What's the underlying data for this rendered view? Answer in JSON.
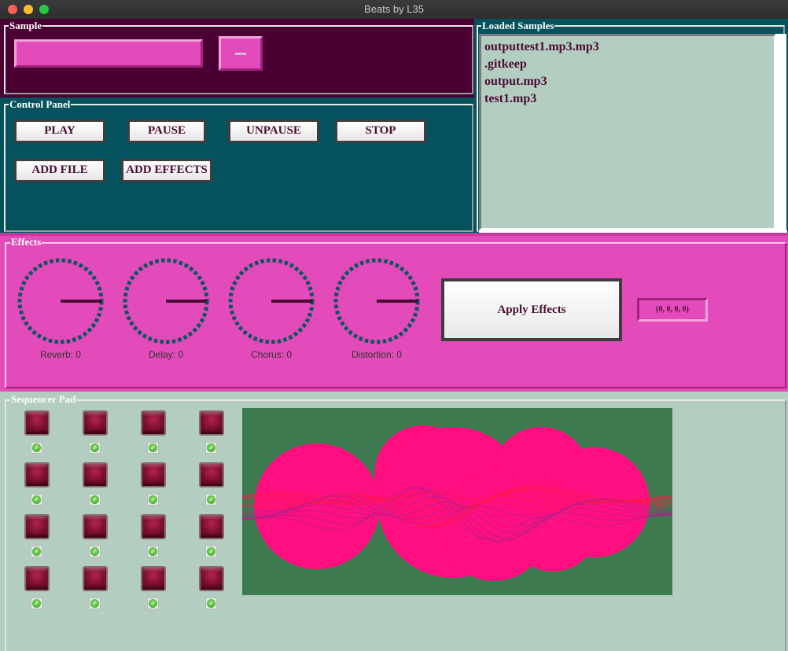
{
  "window": {
    "title": "Beats by L35"
  },
  "sample": {
    "legend": "Sample",
    "input_value": "",
    "button_label": "—"
  },
  "control_panel": {
    "legend": "Control Panel",
    "buttons": [
      "PLAY",
      "PAUSE",
      "UNPAUSE",
      "STOP",
      "ADD FILE",
      "ADD EFFECTS"
    ]
  },
  "loaded_samples": {
    "legend": "Loaded Samples",
    "items": [
      "outputtest1.mp3.mp3",
      ".gitkeep",
      "output.mp3",
      "test1.mp3"
    ]
  },
  "effects": {
    "legend": "Effects",
    "knobs": [
      {
        "label": "Reverb: 0",
        "value": 0
      },
      {
        "label": "Delay: 0",
        "value": 0
      },
      {
        "label": "Chorus: 0",
        "value": 0
      },
      {
        "label": "Distortion: 0",
        "value": 0
      }
    ],
    "apply_label": "Apply Effects",
    "values_readout": "(0, 0, 0, 0)"
  },
  "sequencer": {
    "legend": "Sequencer Pad",
    "rows": 4,
    "cols": 4,
    "checked": [
      [
        true,
        true,
        true,
        true
      ],
      [
        true,
        true,
        true,
        true
      ],
      [
        true,
        true,
        true,
        true
      ],
      [
        true,
        true,
        true,
        true
      ]
    ]
  },
  "colors": {
    "sample_bg": "#4a0033",
    "control_bg": "#04525d",
    "effects_bg": "#e24bb9",
    "sequencer_bg": "#b3cdc1",
    "list_bg": "#b3cdc1",
    "visualizer_bg": "#3d7a4f",
    "accent_pink": "#ff0f80"
  }
}
